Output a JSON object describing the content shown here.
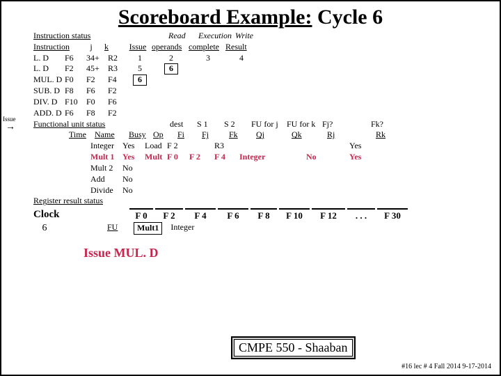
{
  "title_a": "Scoreboard Example:",
  "title_b": "  Cycle 6",
  "hdr": {
    "instr_status": "Instruction status",
    "read": "Read",
    "exec": "Execution",
    "write": "Write",
    "instruction": "Instruction",
    "j": "j",
    "k": "k",
    "issue": "Issue",
    "operands": "operands",
    "complete": "complete",
    "result": "Result"
  },
  "ins": [
    {
      "op": "L. D",
      "fi": "F6",
      "j": "34+",
      "k": "R2",
      "issue": "1",
      "read": "2",
      "exec": "3",
      "write": "4"
    },
    {
      "op": "L. D",
      "fi": "F2",
      "j": "45+",
      "k": "R3",
      "issue": "5",
      "read": "6",
      "exec": "",
      "write": ""
    },
    {
      "op": "MUL. D",
      "fi": "F0",
      "j": "F2",
      "k": "F4",
      "issue": "6",
      "read": "",
      "exec": "",
      "write": ""
    },
    {
      "op": "SUB. D",
      "fi": "F8",
      "j": "F6",
      "k": "F2",
      "issue": "",
      "read": "",
      "exec": "",
      "write": ""
    },
    {
      "op": "DIV. D",
      "fi": "F10",
      "j": "F0",
      "k": "F6",
      "issue": "",
      "read": "",
      "exec": "",
      "write": ""
    },
    {
      "op": "ADD. D",
      "fi": "F6",
      "j": "F8",
      "k": "F2",
      "issue": "",
      "read": "",
      "exec": "",
      "write": ""
    }
  ],
  "fu": {
    "status": "Functional unit status",
    "time": "Time",
    "name": "Name",
    "busy": "Busy",
    "op": "Op",
    "dest": "dest",
    "fi": "Fi",
    "s1": "S 1",
    "fj": "Fj",
    "s2": "S 2",
    "fk": "Fk",
    "fuj": "FU for j",
    "qj": "Qj",
    "fuk": "FU for k",
    "qk": "Qk",
    "rjq": "Fj?",
    "rj": "Rj",
    "rkq": "Fk?",
    "rk": "Rk"
  },
  "units": [
    {
      "name": "Integer",
      "busy": "Yes",
      "op": "Load",
      "dest": "F 2",
      "s1": "",
      "s2": "R3",
      "fuj": "",
      "fuk": "",
      "rj": "",
      "rk": "Yes"
    },
    {
      "name": "Mult 1",
      "busy": "Yes",
      "op": "Mult",
      "dest": "F 0",
      "s1": "F 2",
      "s2": "F 4",
      "fuj": "Integer",
      "fuk": "",
      "rj": "No",
      "rk": "Yes",
      "hot": true
    },
    {
      "name": "Mult 2",
      "busy": "No",
      "op": "",
      "dest": "",
      "s1": "",
      "s2": "",
      "fuj": "",
      "fuk": "",
      "rj": "",
      "rk": ""
    },
    {
      "name": "Add",
      "busy": "No",
      "op": "",
      "dest": "",
      "s1": "",
      "s2": "",
      "fuj": "",
      "fuk": "",
      "rj": "",
      "rk": ""
    },
    {
      "name": "Divide",
      "busy": "No",
      "op": "",
      "dest": "",
      "s1": "",
      "s2": "",
      "fuj": "",
      "fuk": "",
      "rj": "",
      "rk": ""
    }
  ],
  "reg": {
    "status": "Register result status",
    "clock": "Clock",
    "val": "6",
    "fu": "FU",
    "cols": [
      "F 0",
      "F 2",
      "F 4",
      "F 6",
      "F 8",
      "F 10",
      "F 12",
      ". . .",
      "F 30"
    ],
    "vals": [
      "Mult1",
      "Integer",
      "",
      "",
      "",
      "",
      "",
      "",
      ""
    ]
  },
  "action": "Issue MUL. D",
  "issue_side": "Issue",
  "footer": "CMPE 550 - Shaaban",
  "subfoot": "#16   lec # 4 Fall 2014   9-17-2014"
}
